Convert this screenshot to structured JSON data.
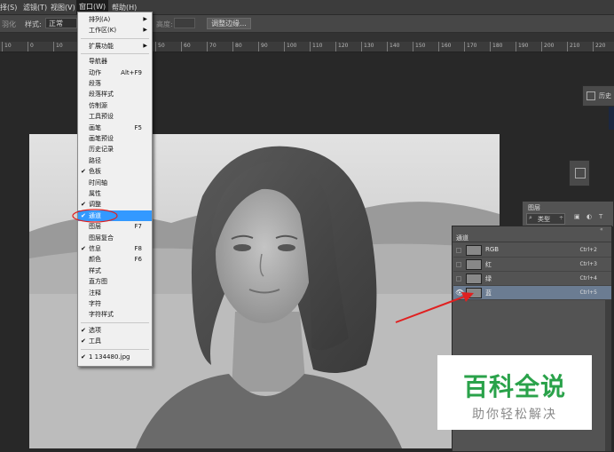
{
  "menubar": {
    "items": [
      "择(S)",
      "滤镜(T)",
      "视图(V)",
      "窗口(W)",
      "帮助(H)"
    ]
  },
  "optionsbar": {
    "feather_label": "羽化",
    "style_label": "样式:",
    "style_value": "正常",
    "height_label": "高度:",
    "refine_button": "调整边缘..."
  },
  "ruler": {
    "ticks": [
      "10",
      "0",
      "10",
      "50",
      "60",
      "70",
      "80",
      "90",
      "100",
      "110",
      "120",
      "130",
      "140",
      "150",
      "160",
      "170",
      "180",
      "190",
      "200",
      "210",
      "220"
    ]
  },
  "window_menu": {
    "items": [
      {
        "label": "排列(A)",
        "submenu": true
      },
      {
        "label": "工作区(K)",
        "submenu": true
      },
      {
        "sep": true
      },
      {
        "label": "扩展功能",
        "submenu": true
      },
      {
        "sep": true
      },
      {
        "label": "导航器"
      },
      {
        "label": "动作",
        "shortcut": "Alt+F9"
      },
      {
        "label": "段落"
      },
      {
        "label": "段落样式"
      },
      {
        "label": "仿制源"
      },
      {
        "label": "工具预设"
      },
      {
        "label": "画笔",
        "shortcut": "F5"
      },
      {
        "label": "画笔预设"
      },
      {
        "label": "历史记录"
      },
      {
        "label": "路径"
      },
      {
        "label": "色板",
        "checked": true
      },
      {
        "label": "时间轴"
      },
      {
        "label": "属性"
      },
      {
        "label": "调整",
        "checked": true
      },
      {
        "label": "通道",
        "checked": true,
        "selected": true
      },
      {
        "label": "图层",
        "shortcut": "F7"
      },
      {
        "label": "图层复合"
      },
      {
        "label": "信息",
        "shortcut": "F8",
        "checked": true
      },
      {
        "label": "颜色",
        "shortcut": "F6"
      },
      {
        "label": "样式"
      },
      {
        "label": "直方图"
      },
      {
        "label": "注释"
      },
      {
        "label": "字符"
      },
      {
        "label": "字符样式"
      },
      {
        "sep": true
      },
      {
        "label": "选项",
        "checked": true
      },
      {
        "label": "工具",
        "checked": true
      },
      {
        "sep": true
      },
      {
        "label": "1 134480.jpg",
        "checked": true
      }
    ]
  },
  "channels_panel": {
    "title": "通道",
    "rows": [
      {
        "name": "RGB",
        "shortcut": "Ctrl+2"
      },
      {
        "name": "红",
        "shortcut": "Ctrl+3"
      },
      {
        "name": "绿",
        "shortcut": "Ctrl+4"
      },
      {
        "name": "蓝",
        "shortcut": "Ctrl+5"
      }
    ]
  },
  "layers_panel": {
    "title": "图层",
    "kind_label": "类型"
  },
  "history_panel": {
    "label": "历史"
  },
  "watermark": {
    "title": "百科全说",
    "subtitle": "助你轻松解决"
  },
  "colors": {
    "menu_highlight": "#3399ff",
    "annotation_red": "#e02020",
    "watermark_green": "#2aa24a"
  }
}
